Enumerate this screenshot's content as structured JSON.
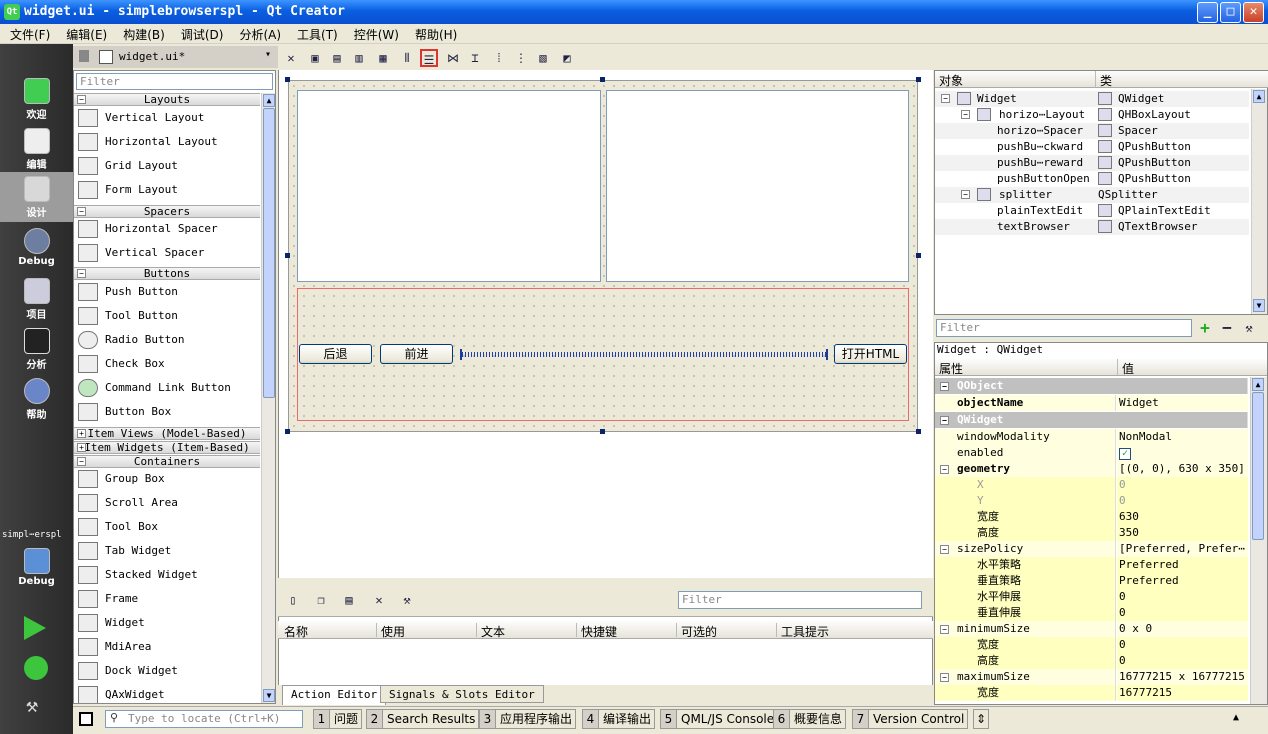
{
  "window": {
    "title": "widget.ui - simplebrowserspl - Qt Creator",
    "minimize": "_",
    "maximize": "□",
    "close": "✕",
    "logo": "Qt"
  },
  "menu": [
    "文件(F)",
    "编辑(E)",
    "构建(B)",
    "调试(D)",
    "分析(A)",
    "工具(T)",
    "控件(W)",
    "帮助(H)"
  ],
  "modes": [
    {
      "label": "欢迎",
      "icon": "qt-logo-icon"
    },
    {
      "label": "编辑",
      "icon": "document-icon"
    },
    {
      "label": "设计",
      "icon": "design-brush-icon"
    },
    {
      "label": "Debug",
      "icon": "debug-bug-icon"
    },
    {
      "label": "项目",
      "icon": "project-folder-icon"
    },
    {
      "label": "分析",
      "icon": "analyze-monitor-icon"
    },
    {
      "label": "帮助",
      "icon": "help-question-icon"
    }
  ],
  "kit": {
    "project": "simpl⋯erspl",
    "config": "Debug"
  },
  "doc_tab": {
    "file": "widget.ui*"
  },
  "widgetbox": {
    "filter_placeholder": "Filter",
    "categories": {
      "layouts": "Layouts",
      "spacers": "Spacers",
      "buttons": "Buttons",
      "item_views": "Item Views (Model-Based)",
      "item_widgets": "Item Widgets (Item-Based)",
      "containers": "Containers"
    },
    "items": {
      "vertical_layout": "Vertical Layout",
      "horizontal_layout": "Horizontal Layout",
      "grid_layout": "Grid Layout",
      "form_layout": "Form Layout",
      "horizontal_spacer": "Horizontal Spacer",
      "vertical_spacer": "Vertical Spacer",
      "push_button": "Push Button",
      "tool_button": "Tool Button",
      "radio_button": "Radio Button",
      "check_box": "Check Box",
      "command_link_button": "Command Link Button",
      "button_box": "Button Box",
      "group_box": "Group Box",
      "scroll_area": "Scroll Area",
      "tool_box": "Tool Box",
      "tab_widget": "Tab Widget",
      "stacked_widget": "Stacked Widget",
      "frame": "Frame",
      "widget": "Widget",
      "mdi_area": "MdiArea",
      "dock_widget": "Dock Widget",
      "qax_widget": "QAxWidget"
    }
  },
  "form": {
    "back": "后退",
    "forward": "前进",
    "open": "打开HTML"
  },
  "action_editor": {
    "filter_placeholder": "Filter",
    "columns": [
      "名称",
      "使用",
      "文本",
      "快捷键",
      "可选的",
      "工具提示"
    ],
    "tabs": {
      "action": "Action Editor",
      "signals": "Signals & Slots Editor"
    }
  },
  "object_inspector": {
    "headers": {
      "object": "对象",
      "class": "类"
    },
    "rows": [
      {
        "name": "Widget",
        "class": "QWidget"
      },
      {
        "name": "horizo⋯Layout",
        "class": "QHBoxLayout"
      },
      {
        "name": "horizo⋯Spacer",
        "class": "Spacer"
      },
      {
        "name": "pushBu⋯ckward",
        "class": "QPushButton"
      },
      {
        "name": "pushBu⋯reward",
        "class": "QPushButton"
      },
      {
        "name": "pushButtonOpen",
        "class": "QPushButton"
      },
      {
        "name": "splitter",
        "class": "QSplitter"
      },
      {
        "name": "plainTextEdit",
        "class": "QPlainTextEdit"
      },
      {
        "name": "textBrowser",
        "class": "QTextBrowser"
      }
    ]
  },
  "property_editor": {
    "filter_placeholder": "Filter",
    "context": "Widget : QWidget",
    "headers": {
      "prop": "属性",
      "value": "值"
    },
    "rows": [
      {
        "kind": "grp",
        "name": "QObject",
        "value": ""
      },
      {
        "kind": "bold",
        "name": "objectName",
        "value": "Widget"
      },
      {
        "kind": "grp",
        "name": "QWidget",
        "value": ""
      },
      {
        "kind": "n",
        "name": "windowModality",
        "value": "NonModal"
      },
      {
        "kind": "n",
        "name": "enabled",
        "value": "✓"
      },
      {
        "kind": "bold-exp",
        "name": "geometry",
        "value": "[(0, 0), 630 x 350]"
      },
      {
        "kind": "dis",
        "name": "X",
        "value": "0"
      },
      {
        "kind": "dis",
        "name": "Y",
        "value": "0"
      },
      {
        "kind": "sub",
        "name": "宽度",
        "value": "630"
      },
      {
        "kind": "sub",
        "name": "高度",
        "value": "350"
      },
      {
        "kind": "exp",
        "name": "sizePolicy",
        "value": "[Preferred, Prefer⋯"
      },
      {
        "kind": "sub",
        "name": "水平策略",
        "value": "Preferred"
      },
      {
        "kind": "sub",
        "name": "垂直策略",
        "value": "Preferred"
      },
      {
        "kind": "sub",
        "name": "水平伸展",
        "value": "0"
      },
      {
        "kind": "sub",
        "name": "垂直伸展",
        "value": "0"
      },
      {
        "kind": "exp",
        "name": "minimumSize",
        "value": "0 x 0"
      },
      {
        "kind": "sub",
        "name": "宽度",
        "value": "0"
      },
      {
        "kind": "sub",
        "name": "高度",
        "value": "0"
      },
      {
        "kind": "exp",
        "name": "maximumSize",
        "value": "16777215 x 16777215"
      },
      {
        "kind": "sub",
        "name": "宽度",
        "value": "16777215"
      }
    ]
  },
  "statusbar": {
    "locate_placeholder": "Type to locate (Ctrl+K)",
    "panes": [
      {
        "num": "1",
        "label": "问题"
      },
      {
        "num": "2",
        "label": "Search Results"
      },
      {
        "num": "3",
        "label": "应用程序输出"
      },
      {
        "num": "4",
        "label": "编译输出"
      },
      {
        "num": "5",
        "label": "QML/JS Console"
      },
      {
        "num": "6",
        "label": "概要信息"
      },
      {
        "num": "7",
        "label": "Version Control"
      }
    ]
  }
}
